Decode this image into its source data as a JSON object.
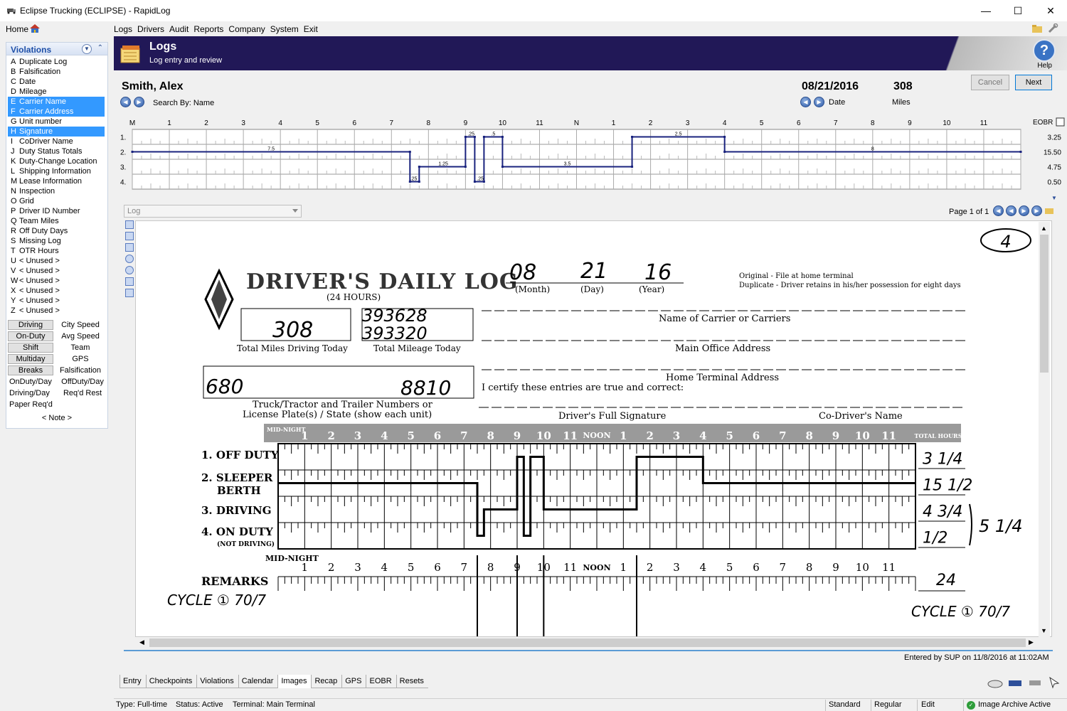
{
  "window": {
    "title": "Eclipse Trucking (ECLIPSE) - RapidLog",
    "minimize": "—",
    "maximize": "☐",
    "close": "✕"
  },
  "menubar": {
    "home": "Home",
    "items": [
      "Logs",
      "Drivers",
      "Audit",
      "Reports",
      "Company",
      "System",
      "Exit"
    ]
  },
  "violations_panel": {
    "title": "Violations",
    "items": [
      {
        "key": "A",
        "label": "Duplicate Log"
      },
      {
        "key": "B",
        "label": "Falsification"
      },
      {
        "key": "C",
        "label": "Date"
      },
      {
        "key": "D",
        "label": "Mileage"
      },
      {
        "key": "E",
        "label": "Carrier Name",
        "selected": true
      },
      {
        "key": "F",
        "label": "Carrier Address",
        "selected": true
      },
      {
        "key": "G",
        "label": "Unit number"
      },
      {
        "key": "H",
        "label": "Signature",
        "selected": true
      },
      {
        "key": "I",
        "label": "CoDriver Name"
      },
      {
        "key": "J",
        "label": "Duty Status Totals"
      },
      {
        "key": "K",
        "label": "Duty-Change Location"
      },
      {
        "key": "L",
        "label": "Shipping Information"
      },
      {
        "key": "M",
        "label": "Lease Information"
      },
      {
        "key": "N",
        "label": "Inspection"
      },
      {
        "key": "O",
        "label": "Grid"
      },
      {
        "key": "P",
        "label": "Driver ID Number"
      },
      {
        "key": "Q",
        "label": "Team Miles"
      },
      {
        "key": "R",
        "label": "Off Duty Days"
      },
      {
        "key": "S",
        "label": "Missing Log"
      },
      {
        "key": "T",
        "label": "OTR Hours"
      },
      {
        "key": "U",
        "label": "< Unused >"
      },
      {
        "key": "V",
        "label": "< Unused >"
      },
      {
        "key": "W",
        "label": "< Unused >"
      },
      {
        "key": "X",
        "label": "< Unused >"
      },
      {
        "key": "Y",
        "label": "< Unused >"
      },
      {
        "key": "Z",
        "label": "< Unused >"
      }
    ],
    "hour_buttons": [
      {
        "button": "Driving",
        "label": "City Speed"
      },
      {
        "button": "On-Duty",
        "label": "Avg Speed"
      },
      {
        "button": "Shift",
        "label": "Team"
      },
      {
        "button": "Multiday",
        "label": "GPS"
      },
      {
        "button": "Breaks",
        "label": "Falsification"
      }
    ],
    "hour_plain": [
      {
        "left": "OnDuty/Day",
        "right": "OffDuty/Day"
      },
      {
        "left": "Driving/Day",
        "right": "Req'd Rest"
      },
      {
        "left": "Paper Req'd",
        "right": ""
      }
    ],
    "note": "< Note >"
  },
  "banner": {
    "title": "Logs",
    "subtitle": "Log entry and review",
    "help": "Help"
  },
  "driver": {
    "name": "Smith, Alex",
    "search_by": "Search By: Name",
    "date": "08/21/2016",
    "miles": "308",
    "date_label": "Date",
    "miles_label": "Miles"
  },
  "buttons": {
    "cancel": "Cancel",
    "next": "Next"
  },
  "grid": {
    "hour_labels": [
      "M",
      "1",
      "2",
      "3",
      "4",
      "5",
      "6",
      "7",
      "8",
      "9",
      "10",
      "11",
      "N",
      "1",
      "2",
      "3",
      "4",
      "5",
      "6",
      "7",
      "8",
      "9",
      "10",
      "11"
    ],
    "row_labels": [
      "1.",
      "2.",
      "3.",
      "4."
    ],
    "eobr_label": "EOBR",
    "totals": [
      "3.25",
      "15.50",
      "4.75",
      "0.50"
    ],
    "segment_labels": [
      {
        "row": 2,
        "text": "7.5",
        "hour": 3.75
      },
      {
        "row": 4,
        "text": ".25",
        "hour": 7.6
      },
      {
        "row": 3,
        "text": "1.25",
        "hour": 8.4
      },
      {
        "row": 1,
        "text": ".25",
        "hour": 9.15
      },
      {
        "row": 4,
        "text": ".25",
        "hour": 9.4
      },
      {
        "row": 1,
        "text": ".5",
        "hour": 9.75
      },
      {
        "row": 3,
        "text": "3.5",
        "hour": 11.75
      },
      {
        "row": 1,
        "text": "2.5",
        "hour": 14.75
      },
      {
        "row": 2,
        "text": "8",
        "hour": 20
      }
    ],
    "segments": [
      {
        "row": 2,
        "start": 0,
        "end": 7.5
      },
      {
        "row": 4,
        "start": 7.5,
        "end": 7.75
      },
      {
        "row": 3,
        "start": 7.75,
        "end": 9.0
      },
      {
        "row": 1,
        "start": 9.0,
        "end": 9.25
      },
      {
        "row": 4,
        "start": 9.25,
        "end": 9.5
      },
      {
        "row": 1,
        "start": 9.5,
        "end": 10.0
      },
      {
        "row": 3,
        "start": 10.0,
        "end": 13.5
      },
      {
        "row": 1,
        "start": 13.5,
        "end": 16.0
      },
      {
        "row": 2,
        "start": 16.0,
        "end": 24.0
      }
    ]
  },
  "viewer": {
    "combo": "Log",
    "page": "Page 1 of 1",
    "entered": "Entered by SUP on 11/8/2016 at 11:02AM"
  },
  "paper_log": {
    "page_number": "4",
    "title": "DRIVER'S DAILY LOG",
    "subtitle": "(24 HOURS)",
    "date_month": "08",
    "date_day": "21",
    "date_year": "16",
    "month_lbl": "(Month)",
    "day_lbl": "(Day)",
    "year_lbl": "(Year)",
    "original": "Original - File at home terminal",
    "duplicate": "Duplicate - Driver retains in his/her possession for eight days",
    "total_miles": "308",
    "total_miles_lbl": "Total Miles Driving Today",
    "mileage_1": "393628",
    "mileage_2": "393320",
    "total_mileage_lbl": "Total Mileage Today",
    "carrier_lbl": "Name of Carrier or Carriers",
    "office_lbl": "Main Office Address",
    "terminal_lbl": "Home Terminal Address",
    "unit_1": "680",
    "unit_2": "8810",
    "unit_lbl_1": "Truck/Tractor and Trailer Numbers or",
    "unit_lbl_2": "License Plate(s) / State (show each unit)",
    "certify": "I certify these entries are true and correct:",
    "signature_lbl": "Driver's Full Signature",
    "codriver_lbl": "Co-Driver's Name",
    "midnight": "MID-NIGHT",
    "noon": "NOON",
    "total_hours": "TOTAL HOURS",
    "rows": [
      "1. OFF DUTY",
      "2. SLEEPER",
      "BERTH",
      "3. DRIVING",
      "4. ON DUTY",
      "(NOT DRIVING)"
    ],
    "hours_written": [
      "3 1/4",
      "15 1/2",
      "4 3/4",
      "1/2"
    ],
    "onduty_total": "5 1/4",
    "grand_total": "24",
    "remarks": "REMARKS",
    "cycle_left": "CYCLE ① 70/7",
    "cycle_right": "CYCLE ① 70/7"
  },
  "tabs": [
    "Entry",
    "Checkpoints",
    "Violations",
    "Calendar",
    "Images",
    "Recap",
    "GPS",
    "EOBR",
    "Resets"
  ],
  "active_tab": "Images",
  "statusbar": {
    "type": "Type: Full-time",
    "status": "Status: Active",
    "terminal": "Terminal: Main Terminal",
    "mode1": "Standard",
    "mode2": "Regular",
    "mode3": "Edit",
    "archive": "Image Archive Active"
  },
  "colors": {
    "banner": "#211857",
    "selection": "#3399ff",
    "grid_line": "#1a237e",
    "accent": "#0078d7"
  }
}
